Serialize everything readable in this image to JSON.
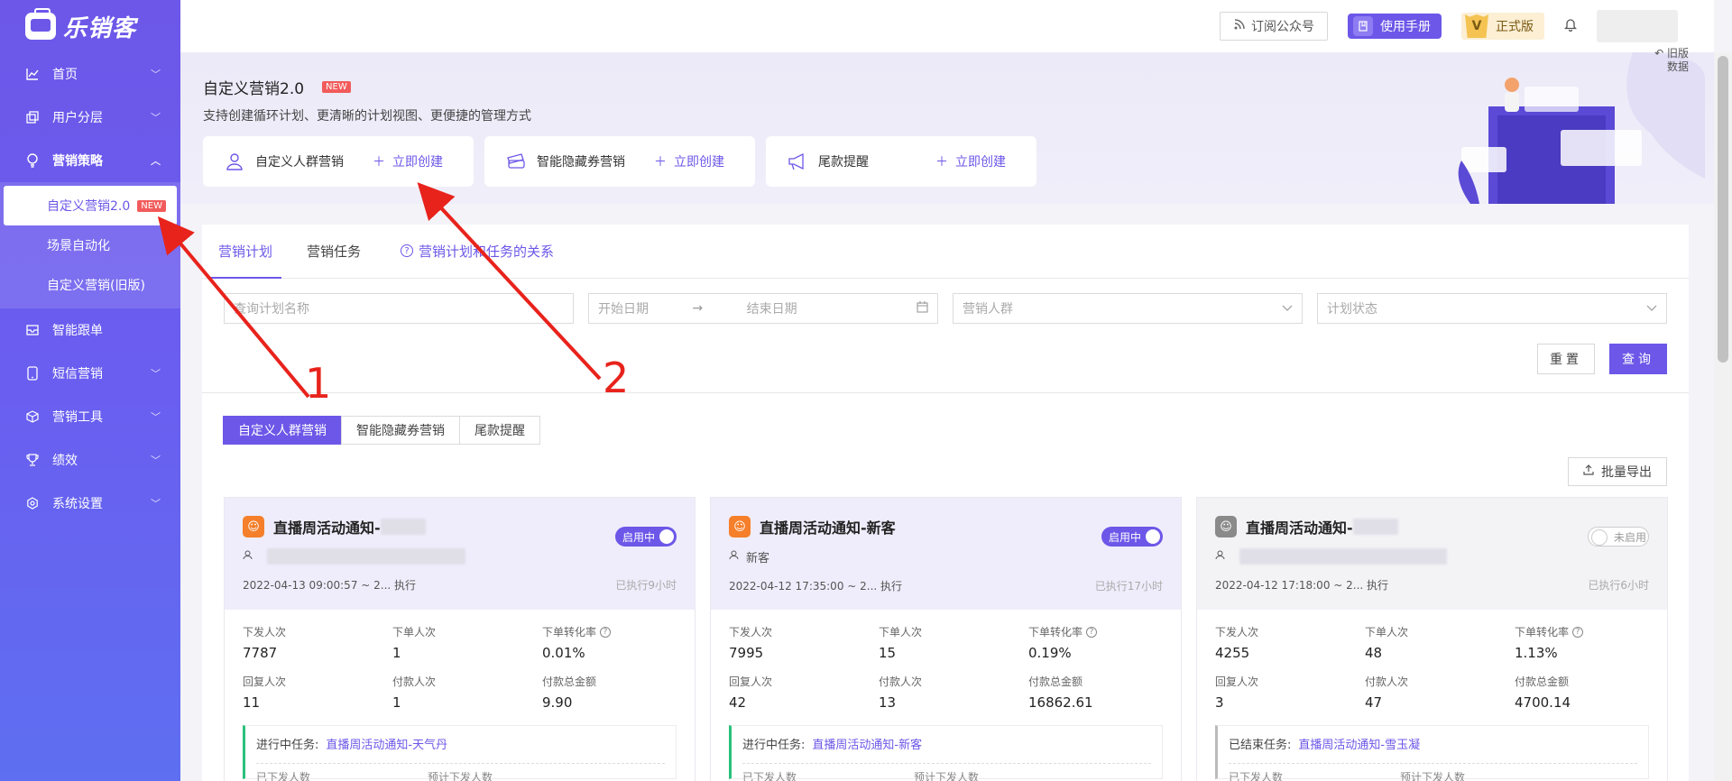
{
  "brand": {
    "name": "乐销客"
  },
  "sidebar": {
    "items": [
      {
        "label": "首页",
        "icon": "chart-icon"
      },
      {
        "label": "用户分层",
        "icon": "layers-icon"
      },
      {
        "label": "营销策略",
        "icon": "bulb-icon",
        "open": true,
        "children": [
          {
            "label": "自定义营销2.0",
            "badge": "NEW",
            "active": true
          },
          {
            "label": "场景自动化"
          },
          {
            "label": "自定义营销(旧版)"
          }
        ]
      },
      {
        "label": "智能跟单",
        "icon": "inbox-icon"
      },
      {
        "label": "短信营销",
        "icon": "phone-icon"
      },
      {
        "label": "营销工具",
        "icon": "cube-icon"
      },
      {
        "label": "绩效",
        "icon": "trophy-icon"
      },
      {
        "label": "系统设置",
        "icon": "settings-icon"
      }
    ]
  },
  "topbar": {
    "subscribe": "订阅公众号",
    "manual": "使用手册",
    "vip_letter": "V",
    "vip": "正式版"
  },
  "hero": {
    "title": "自定义营销2.0",
    "badge": "NEW",
    "description": "支持创建循环计划、更清晰的计划视图、更便捷的管理方式",
    "legacy": "旧版数据",
    "cards": [
      {
        "label": "自定义人群营销",
        "action": "立即创建",
        "icon": "user-icon"
      },
      {
        "label": "智能隐藏券营销",
        "action": "立即创建",
        "icon": "coupon-icon"
      },
      {
        "label": "尾款提醒",
        "action": "立即创建",
        "icon": "megaphone-icon"
      }
    ]
  },
  "main": {
    "tabs": [
      "营销计划",
      "营销任务"
    ],
    "help_link": "营销计划和任务的关系",
    "filters": {
      "name_placeholder": "查询计划名称",
      "start_placeholder": "开始日期",
      "arrow": "→",
      "end_placeholder": "结束日期",
      "audience_placeholder": "营销人群",
      "status_placeholder": "计划状态"
    },
    "reset": "重置",
    "query": "查询",
    "segments": [
      "自定义人群营销",
      "智能隐藏券营销",
      "尾款提醒"
    ],
    "export": "批量导出",
    "stat_labels": [
      "下发人次",
      "下单人次",
      "下单转化率",
      "回复人次",
      "付款人次",
      "付款总金额"
    ],
    "task_sub_labels": [
      "已下发人数",
      "预计下发人数"
    ]
  },
  "cards": [
    {
      "title": "直播周活动通知-",
      "status": "启用中",
      "enabled": true,
      "audience": "",
      "time": "2022-04-13 09:00:57 ~ 2... 执行",
      "elapsed": "已执行9小时",
      "stats": [
        "7787",
        "1",
        "0.01%",
        "11",
        "1",
        "9.90"
      ],
      "task_prefix": "进行中任务:",
      "task_name": "直播周活动通知-天气丹"
    },
    {
      "title": "直播周活动通知-新客",
      "status": "启用中",
      "enabled": true,
      "audience": "新客",
      "time": "2022-04-12 17:35:00 ~ 2... 执行",
      "elapsed": "已执行17小时",
      "stats": [
        "7995",
        "15",
        "0.19%",
        "42",
        "13",
        "16862.61"
      ],
      "task_prefix": "进行中任务:",
      "task_name": "直播周活动通知-新客"
    },
    {
      "title": "直播周活动通知-",
      "status": "未启用",
      "enabled": false,
      "audience": "",
      "time": "2022-04-12 17:18:00 ~ 2... 执行",
      "elapsed": "已执行6小时",
      "stats": [
        "4255",
        "48",
        "1.13%",
        "3",
        "47",
        "4700.14"
      ],
      "task_prefix": "已结束任务:",
      "task_name": "直播周活动通知-雪玉凝"
    }
  ],
  "annotations": {
    "num1": "1",
    "num2": "2",
    "color": "#e8231c"
  },
  "colors": {
    "accent": "#6c57e8",
    "active_task": "#28c17a",
    "new_badge": "#f25b5b"
  }
}
